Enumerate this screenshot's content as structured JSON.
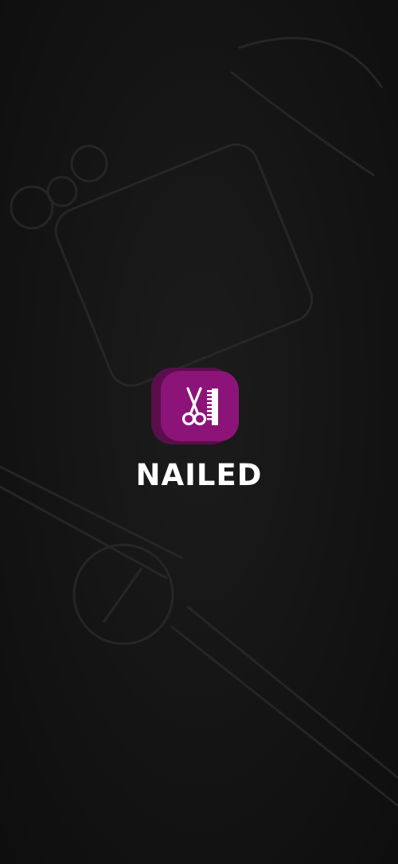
{
  "app": {
    "name": "NAILED",
    "logo_icon": "scissors-comb-icon"
  },
  "colors": {
    "background": "#131313",
    "logo_primary": "#8c1479",
    "logo_shadow": "#5a0f4c",
    "text": "#ffffff"
  }
}
